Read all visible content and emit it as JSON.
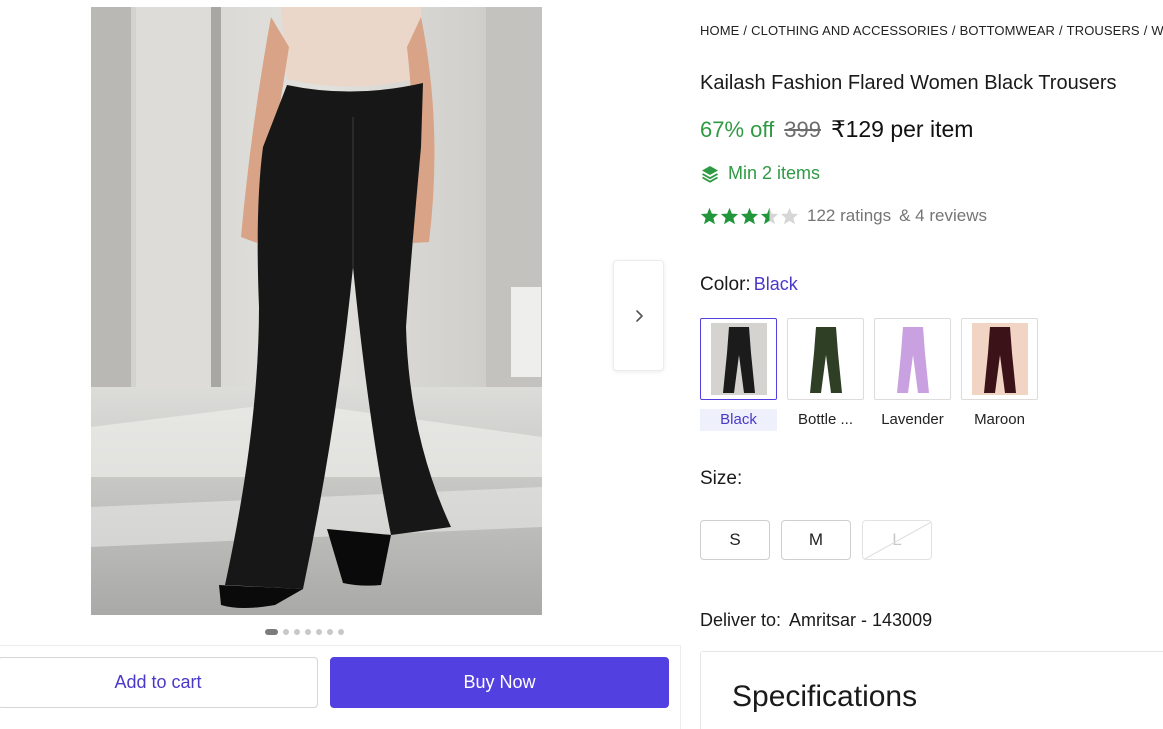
{
  "gallery": {
    "image_alt": "Black flared trousers worn by model",
    "dot_count": 7,
    "active_dot": 0,
    "next_icon": "chevron-right-icon"
  },
  "actions": {
    "add_to_cart": "Add to cart",
    "buy_now": "Buy Now",
    "accent_color": "#5340e0"
  },
  "breadcrumb": [
    "HOME",
    "CLOTHING AND ACCESSORIES",
    "BOTTOMWEAR",
    "TROUSERS",
    "WOMEN TROUSERS"
  ],
  "product": {
    "title": "Kailash Fashion Flared Women Black Trousers",
    "discount": "67% off",
    "mrp": "399",
    "price": "₹129 per item",
    "min_items": "Min 2 items",
    "min_items_icon": "layers-icon",
    "rating": 3.5,
    "ratings_text": "122 ratings",
    "reviews_text": "& 4 reviews"
  },
  "color": {
    "label": "Color:",
    "selected": "Black",
    "options": [
      {
        "name": "Black",
        "swatch": "#1b1b1b"
      },
      {
        "name": "Bottle ...",
        "swatch": "#2f3f25"
      },
      {
        "name": "Lavender",
        "swatch": "#c9a0e0"
      },
      {
        "name": "Maroon",
        "swatch": "#3b1218"
      }
    ]
  },
  "size": {
    "label": "Size:",
    "options": [
      {
        "label": "S",
        "available": true
      },
      {
        "label": "M",
        "available": true
      },
      {
        "label": "L",
        "available": false
      }
    ]
  },
  "delivery": {
    "label": "Deliver to:",
    "location": "Amritsar - 143009"
  },
  "specifications": {
    "title": "Specifications"
  }
}
